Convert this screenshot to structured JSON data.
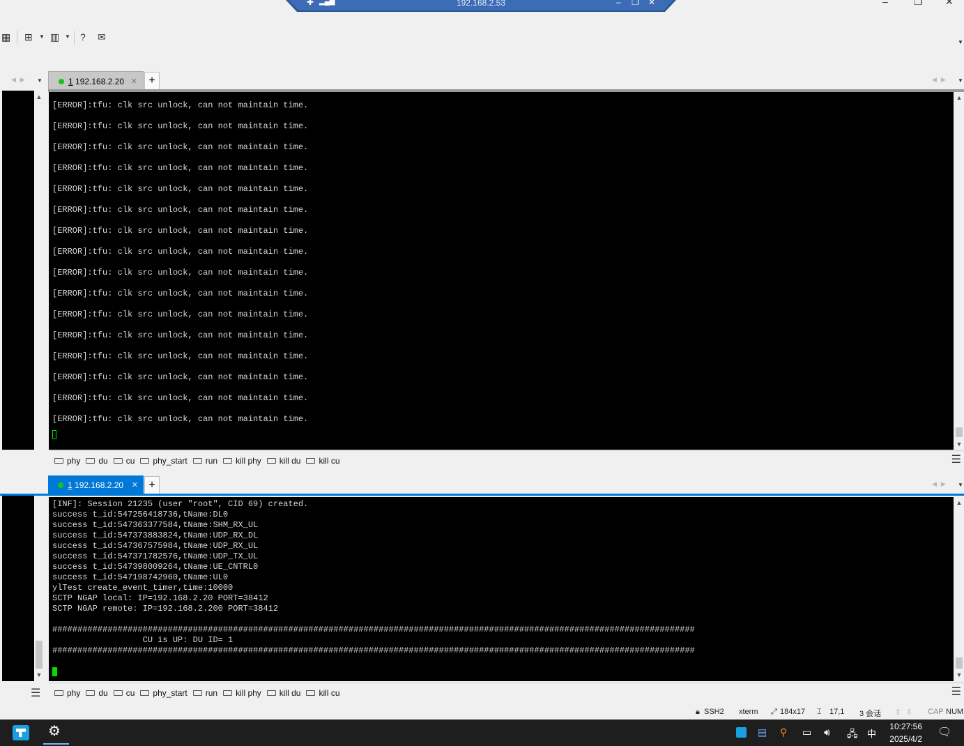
{
  "remote_bar": {
    "title": "192.168.2.53"
  },
  "toolbar": {
    "icons": [
      "calendar-icon",
      "new-tab-icon",
      "layout-icon",
      "help-icon",
      "chat-icon"
    ]
  },
  "session_top": {
    "tab_number": "1",
    "tab_host": "192.168.2.20",
    "lines": [
      "[ERROR]:tfu: clk src unlock, can not maintain time.",
      "[ERROR]:tfu: clk src unlock, can not maintain time.",
      "[ERROR]:tfu: clk src unlock, can not maintain time.",
      "[ERROR]:tfu: clk src unlock, can not maintain time.",
      "[ERROR]:tfu: clk src unlock, can not maintain time.",
      "[ERROR]:tfu: clk src unlock, can not maintain time.",
      "[ERROR]:tfu: clk src unlock, can not maintain time.",
      "[ERROR]:tfu: clk src unlock, can not maintain time.",
      "[ERROR]:tfu: clk src unlock, can not maintain time.",
      "[ERROR]:tfu: clk src unlock, can not maintain time.",
      "[ERROR]:tfu: clk src unlock, can not maintain time.",
      "[ERROR]:tfu: clk src unlock, can not maintain time.",
      "[ERROR]:tfu: clk src unlock, can not maintain time.",
      "[ERROR]:tfu: clk src unlock, can not maintain time.",
      "[ERROR]:tfu: clk src unlock, can not maintain time.",
      "[ERROR]:tfu: clk src unlock, can not maintain time."
    ]
  },
  "session_bottom": {
    "tab_number": "1",
    "tab_host": "192.168.2.20",
    "lines": [
      "[INF]: Session 21235 (user \"root\", CID 69) created.",
      "success t_id:547256418736,tName:DL0",
      "success t_id:547363377584,tName:SHM_RX_UL",
      "success t_id:547373883824,tName:UDP_RX_DL",
      "success t_id:547367575984,tName:UDP_RX_UL",
      "success t_id:547371782576,tName:UDP_TX_UL",
      "success t_id:547398009264,tName:UE_CNTRL0",
      "success t_id:547198742960,tName:UL0",
      "ylTest create_event_timer,time:10000",
      "SCTP NGAP local: IP=192.168.2.20 PORT=38412",
      "SCTP NGAP remote: IP=192.168.2.200 PORT=38412",
      "",
      "################################################################################################################################",
      "                  CU is UP: DU ID= 1",
      "################################################################################################################################"
    ]
  },
  "button_bar": [
    "phy",
    "du",
    "cu",
    "phy_start",
    "run",
    "kill phy",
    "kill du",
    "kill cu"
  ],
  "status_bar": {
    "protocol": "SSH2",
    "terminal": "xterm",
    "size": "184x17",
    "cursor": "17,1",
    "sessions": "3 会话",
    "cap": "CAP",
    "num": "NUM"
  },
  "taskbar": {
    "time": "10:27:56",
    "date": "2025/4/2",
    "ime": "中"
  },
  "colors": {
    "active_tab": "#0078d7",
    "cursor": "#00e000",
    "terminal_bg": "#000000"
  }
}
